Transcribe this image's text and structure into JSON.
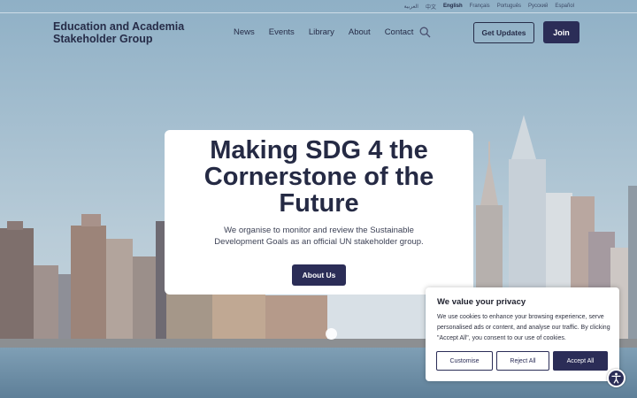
{
  "languages": [
    {
      "label": "العربية",
      "active": false
    },
    {
      "label": "中文",
      "active": false
    },
    {
      "label": "English",
      "active": true
    },
    {
      "label": "Français",
      "active": false
    },
    {
      "label": "Português",
      "active": false
    },
    {
      "label": "Русский",
      "active": false
    },
    {
      "label": "Español",
      "active": false
    }
  ],
  "header": {
    "logo": "Education and Academia Stakeholder Group",
    "nav": [
      "News",
      "Events",
      "Library",
      "About",
      "Contact"
    ],
    "search_icon": "search-icon",
    "updates_label": "Get Updates",
    "join_label": "Join"
  },
  "hero": {
    "title": "Making SDG 4 the Cornerstone of the Future",
    "subtitle": "We organise to monitor and review the Sustainable Development Goals as an official UN stakeholder group.",
    "button_label": "About Us"
  },
  "cookie": {
    "title": "We value your privacy",
    "text": "We use cookies to enhance your browsing experience, serve personalised ads or content, and analyse our traffic. By clicking \"Accept All\", you consent to our use of cookies.",
    "customise_label": "Customise",
    "reject_label": "Reject All",
    "accept_label": "Accept All"
  },
  "colors": {
    "brand": "#2b2d57",
    "text_dark": "#262c48",
    "sky": "#9fb8c8"
  },
  "accessibility_icon": "accessibility-icon"
}
